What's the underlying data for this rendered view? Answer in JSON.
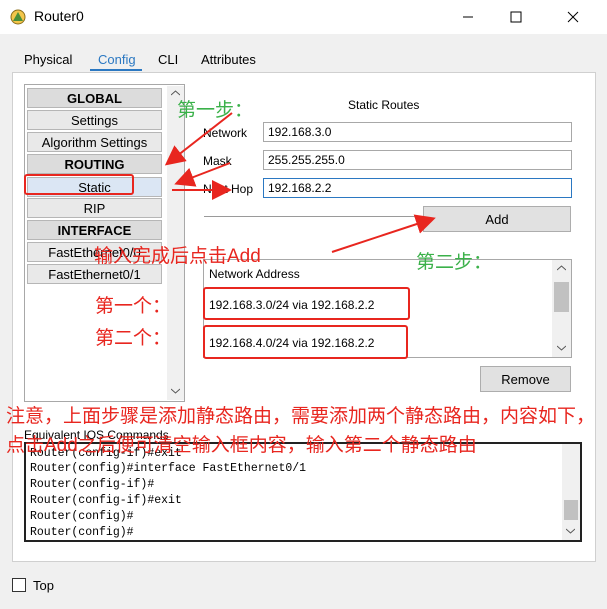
{
  "window": {
    "title": "Router0",
    "controls": [
      "minimize",
      "maximize",
      "close"
    ]
  },
  "tabs": [
    {
      "label": "Physical",
      "active": false
    },
    {
      "label": "Config",
      "active": true
    },
    {
      "label": "CLI",
      "active": false
    },
    {
      "label": "Attributes",
      "active": false
    }
  ],
  "nav": {
    "items": [
      {
        "label": "GLOBAL",
        "type": "header"
      },
      {
        "label": "Settings",
        "type": "item"
      },
      {
        "label": "Algorithm Settings",
        "type": "item"
      },
      {
        "label": "ROUTING",
        "type": "header"
      },
      {
        "label": "Static",
        "type": "item",
        "selected": true
      },
      {
        "label": "RIP",
        "type": "item"
      },
      {
        "label": "INTERFACE",
        "type": "header"
      },
      {
        "label": "FastEthernet0/0",
        "type": "item"
      },
      {
        "label": "FastEthernet0/1",
        "type": "item"
      }
    ]
  },
  "static_routes": {
    "title": "Static Routes",
    "network_label": "Network",
    "network_value": "192.168.3.0",
    "mask_label": "Mask",
    "mask_value": "255.255.255.0",
    "next_hop_label": "Next Hop",
    "next_hop_value": "192.168.2.2",
    "add_button": "Add",
    "list_header": "Network Address",
    "routes": [
      "192.168.3.0/24 via 192.168.2.2",
      "192.168.4.0/24 via 192.168.2.2"
    ],
    "remove_button": "Remove"
  },
  "console": {
    "label": "Equivalent IOS Commands",
    "lines": [
      "Router(config-if)#exit",
      "Router(config)#interface FastEthernet0/1",
      "Router(config-if)#",
      "Router(config-if)#exit",
      "Router(config)#",
      "Router(config)#"
    ]
  },
  "footer": {
    "top_checkbox_label": "Top",
    "top_checked": false
  },
  "annotations": {
    "step1": "第一步：",
    "step2": "第二步：",
    "click_add": "输入完成后点击Add",
    "first": "第一个：",
    "second": "第二个：",
    "note": "注意，上面步骤是添加静态路由，需要添加两个静态路由，内容如下，点击Add之后便可清空输入框内容，输入第二个静态路由"
  },
  "colors": {
    "accent": "#2b78c2",
    "annotation_red": "#e8261f",
    "annotation_green": "#3bb14a"
  }
}
